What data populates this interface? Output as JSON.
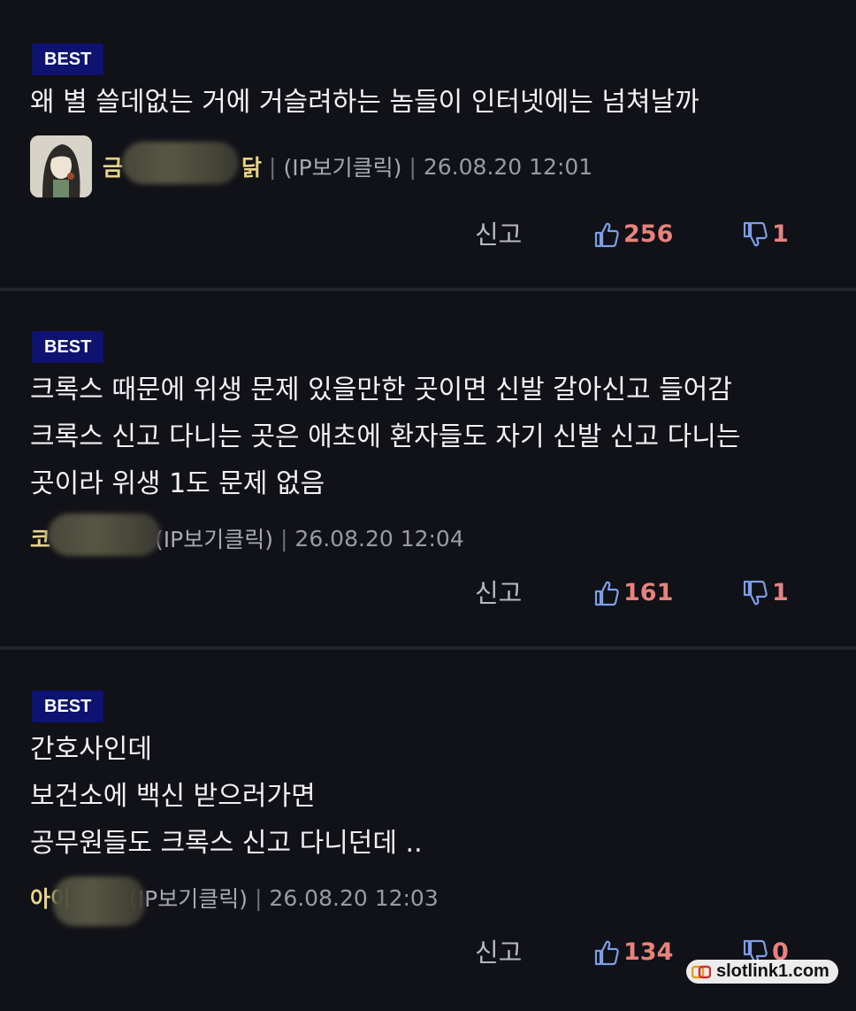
{
  "comments": [
    {
      "badge": "BEST",
      "text": "왜 별 쓸데없는 거에 거슬려하는 놈들이 인터넷에는 넘쳐날까",
      "author_first": "금",
      "author_last": "닭",
      "ip_label": "(IP보기클릭)",
      "timestamp": "26.08.20 12:01",
      "report_label": "신고",
      "likes": "256",
      "dislikes": "1"
    },
    {
      "badge": "BEST",
      "text": "크록스 때문에 위생 문제 있을만한 곳이면 신발 갈아신고 들어감\n크록스 신고 다니는 곳은 애초에 환자들도 자기 신발 신고 다니는\n곳이라 위생 1도 문제 없음",
      "author_first": "코",
      "author_last": "",
      "ip_label": "(IP보기클릭)",
      "timestamp": "26.08.20 12:04",
      "report_label": "신고",
      "likes": "161",
      "dislikes": "1"
    },
    {
      "badge": "BEST",
      "text": "간호사인데\n보건소에 백신 받으러가면\n공무원들도 크록스 신고 다니던데 ..",
      "author_first": "아이",
      "author_last": "",
      "ip_label": "(IP보기클릭)",
      "timestamp": "26.08.20 12:03",
      "report_label": "신고",
      "likes": "134",
      "dislikes": "0"
    }
  ],
  "watermark": {
    "text": "slotlink1.com"
  },
  "colors": {
    "background": "#111118",
    "badge": "#0e1270",
    "nickname": "#e8d58a",
    "vote_count": "#e7827d",
    "vote_icon": "#7c9fe6"
  },
  "icons": [
    "thumbs-up-icon",
    "thumbs-down-icon",
    "avatar"
  ]
}
